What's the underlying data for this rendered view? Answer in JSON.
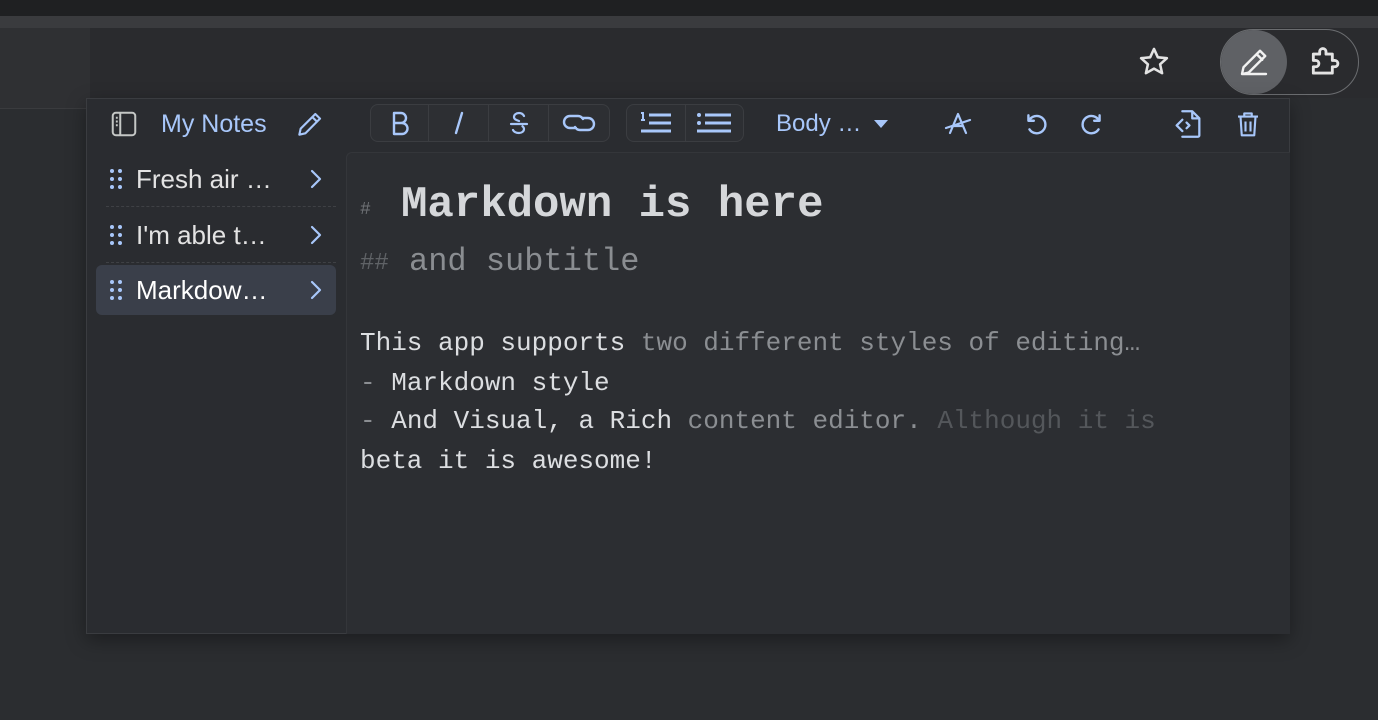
{
  "extension": {
    "sidebar_title": "My Notes",
    "toolbar": {
      "block_style": "Body …"
    },
    "notes": [
      {
        "title": "Fresh air …"
      },
      {
        "title": "I'm able t…"
      },
      {
        "title": "Markdow…"
      }
    ],
    "editor": {
      "h1_mark": "#",
      "h1": "Markdown is here",
      "h2_mark": "##",
      "h2": "and subtitle",
      "p1a": "This app supports ",
      "p1b": "two different styles of editing…",
      "p2a": "- ",
      "p2b": "Markdown style",
      "p3a": "- ",
      "p3b": "And Visual, a Rich ",
      "p3c": "content editor. ",
      "p3d": "Although it is",
      "p4": "beta it is awesome!"
    }
  }
}
